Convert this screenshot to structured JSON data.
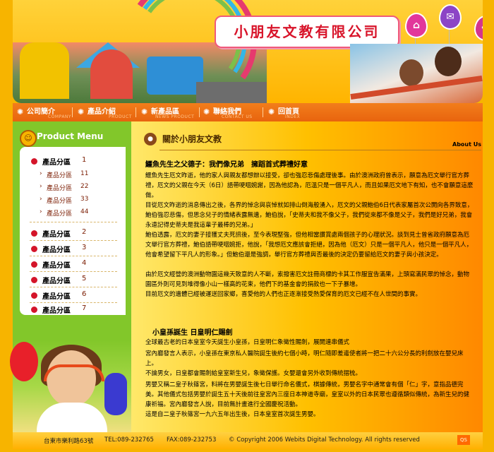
{
  "header": {
    "site_title": "小朋友文教有限公司",
    "balloons": [
      {
        "icon": "home-icon",
        "glyph": "⌂",
        "color": "#e2379b"
      },
      {
        "icon": "mail-icon",
        "glyph": "✉",
        "color": "#8c44c6"
      },
      {
        "icon": "plus-icon",
        "glyph": "✚",
        "color": "#d4358e"
      }
    ]
  },
  "nav": {
    "items": [
      {
        "label": "公司簡介",
        "sub": "COMPANY"
      },
      {
        "label": "產品介紹",
        "sub": "PRODUCT"
      },
      {
        "label": "新產品區",
        "sub": "NEWS PRODUCT"
      },
      {
        "label": "聯絡我們",
        "sub": "CONTACT US"
      },
      {
        "label": "回首頁",
        "sub": "INDEX"
      }
    ]
  },
  "sidebar": {
    "menu_title": "Product Menu",
    "categories": [
      {
        "label": "產品分區",
        "num": "1"
      },
      {
        "label": "產品分區",
        "num": "2"
      },
      {
        "label": "產品分區",
        "num": "3"
      },
      {
        "label": "產品分區",
        "num": "4"
      },
      {
        "label": "產品分區",
        "num": "5"
      },
      {
        "label": "產品分區",
        "num": "6"
      },
      {
        "label": "產品分區",
        "num": "7"
      }
    ],
    "subitems": [
      {
        "label": "產品分區",
        "num": "11"
      },
      {
        "label": "產品分區",
        "num": "22"
      },
      {
        "label": "產品分區",
        "num": "33"
      },
      {
        "label": "產品分區",
        "num": "44"
      }
    ]
  },
  "main": {
    "section_title": "關於小朋友文教",
    "about_label": "About Us",
    "article1": {
      "title": "鱷魚先生之父德子：我們像兄弟　擁蹈首式葬禮好意",
      "paragraphs": [
        "鱷魚先生厄文昨逝，他的家人與親友都想辦以接受，卻也強忍悲傷處理後事。由於澳洲政府曾表示，願意為厄文舉行官方葬禮，厄文的父親在今天（6日）語帶哽咽婉謝，因為他認為，厄溫只是一個平凡人，而且如果厄文地下有知，也不會願意這麼做。",
        "目從厄文昨逝的消息傳出之後，各界的悼念與哀悼就如排山倒海般湧入，厄文的父親鮑伯6日代表家屬首次公開向各界致意，鮑伯強忍悲傷，但思念兒子的情緒表露無遺，鮑伯說，「史蒂夫和我不像父子，我們從來都不像是父子，我們是好兄弟，我會永遠記得史蒂夫是我這輩子最棒的兄弟。」",
        "鮑伯透露，厄文的妻子接獲丈夫死訊後，至今表現堅強，但他相當讚賞處兩個孩子的心理狀況。談到見士曾省政府願意為厄文舉行官方葬禮，鮑伯語帶哽咽婉拒，他說，「我想厄文應該會拒絕，因為他（厄文）只是一個平凡人，他只是一個平凡人，他會希望留下平凡人的形象。」但鮑伯還是強調，舉行官方葬禮與否最後的決定仍要留給厄文的妻子與小孩決定。",
        "由於厄文經營的澳洲動物園這幾天致意的人不斷，索撥害厄文註冊商標的卡其工作服宣告滿果，上頭寫滿民眾的悼念，動物園區外則可見到堆得像小山一樣高的花束，他們下的基金會的捐款也一下子暴增。",
        "目前厄文的遺體已經被運送回家鄉，喜愛他的人們也正逐漸接受熱愛保育的厄文已經不在人世間的事實。"
      ]
    },
    "article2": {
      "title": "小皇孫誕生 日皇明仁賜劍",
      "paragraphs": [
        "全球最古老的日本皇室今天誕生小皇孫，日皇明仁象徵性賜劍，展開連串儀式",
        "宮內廳發言人表示，小皇孫在東京私人醫院誕生後約七個小時，明仁隨即差遣使者將一把二十六公分長的利劍放在嬰兒床上。",
        "不論男女，日皇都會賜劍給皇室新生兒，象徵保護。女嬰還會另外收到傳統摺梳。",
        "男嬰又稱二皇子秋篠宮，料將在男嬰誕生後七日舉行命名儀式，棋據傳統，男嬰名字中通常會有個「仁」字，意指品德完美。其他儀式包括男嬰於誕生五十天後前往皇宮內三座日本神道寺廟，皇室以外的日本民眾也遵循類似傳統，為新生兒的健康祈福。宮內廳發言人說，目前無計畫進行全國慶祝活動。",
        "這是自二皇子秋篠宮一九六五年出生後，日本皇室首次誕生男嬰。"
      ]
    }
  },
  "footer": {
    "address": "台東市樂利路63號",
    "tel": "TEL:089-232765",
    "fax": "FAX:089-232753",
    "copyright": "© Copyright 2006 Webits Digital Technology. All rights reserved",
    "badge": "QS"
  }
}
